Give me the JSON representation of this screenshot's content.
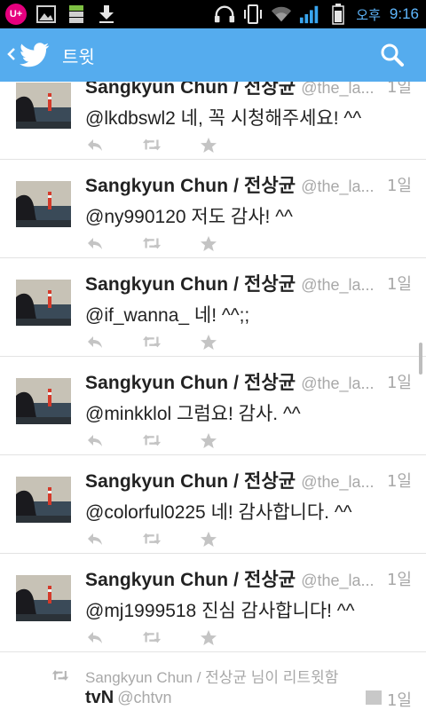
{
  "status_bar": {
    "carrier_icon_text": "U+",
    "icons_left": [
      "uplus-icon",
      "gallery-icon",
      "storage-icon",
      "download-icon"
    ],
    "icons_right": [
      "headset-icon",
      "vibrate-icon",
      "wifi-icon",
      "signal-icon",
      "battery-icon"
    ],
    "ampm": "오후",
    "time": "9:16"
  },
  "action_bar": {
    "title": "트윗",
    "back_icon": "chevron-left-icon",
    "logo_icon": "twitter-bird-icon",
    "search_icon": "search-icon",
    "color": "#55acee"
  },
  "tweets": [
    {
      "name": "Sangkyun Chun / 전상균",
      "handle": "@the_la...",
      "time": "1일",
      "text": "@lkdbswl2 네, 꼭 시청해주세요! ^^"
    },
    {
      "name": "Sangkyun Chun / 전상균",
      "handle": "@the_la...",
      "time": "1일",
      "text": "@ny990120 저도 감사! ^^"
    },
    {
      "name": "Sangkyun Chun / 전상균",
      "handle": "@the_la...",
      "time": "1일",
      "text": "@if_wanna_ 네! ^^;;"
    },
    {
      "name": "Sangkyun Chun / 전상균",
      "handle": "@the_la...",
      "time": "1일",
      "text": "@minkklol 그럼요! 감사. ^^"
    },
    {
      "name": "Sangkyun Chun / 전상균",
      "handle": "@the_la...",
      "time": "1일",
      "text": "@colorful0225 네! 감사합니다. ^^"
    },
    {
      "name": "Sangkyun Chun / 전상균",
      "handle": "@the_la...",
      "time": "1일",
      "text": "@mj1999518 진심 감사합니다! ^^"
    }
  ],
  "retweet": {
    "label": "Sangkyun Chun / 전상균 님이 리트윗함",
    "name": "tvN",
    "handle": "@chtvn",
    "time": "1일"
  }
}
